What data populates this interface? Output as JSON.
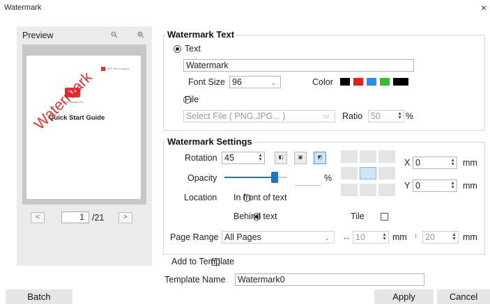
{
  "window": {
    "title": "Watermark",
    "close_glyph": "×"
  },
  "preview": {
    "label": "Preview",
    "zoom_out_icon": "zoom-out-icon",
    "zoom_in_icon": "zoom-in-icon",
    "document": {
      "logo_text": "PDF Technologies",
      "badge": "PDF",
      "badge_sub": "PDF Reader Pro",
      "title": "Quick Start Guide",
      "watermark": "Watermark"
    },
    "page_current": "1",
    "page_total": "/21",
    "prev_glyph": "<",
    "next_glyph": ">"
  },
  "watermark_text": {
    "title": "Watermark Text",
    "text_option": "Text",
    "text_value": "Watermark",
    "font_size_label": "Font Size",
    "font_size_value": "96",
    "color_label": "Color",
    "colors": [
      "#000000",
      "#ef1c1c",
      "#2f8af0",
      "#2fc12f",
      "#000000"
    ],
    "file_option": "File",
    "file_placeholder": "Select File ( PNG,JPG... )",
    "ratio_label": "Ratio",
    "ratio_value": "50",
    "ratio_unit": "%"
  },
  "watermark_settings": {
    "title": "Watermark Settings",
    "rotation_label": "Rotation",
    "rotation_value": "45",
    "opacity_label": "Opacity",
    "opacity_value": 0.8,
    "opacity_unit": "%",
    "location_label": "Location",
    "front_option": "In front of text",
    "behind_option": "Behind text",
    "tile_label": "Tile",
    "x_label": "X",
    "x_value": "0",
    "y_label": "Y",
    "y_value": "0",
    "unit_mm": "mm",
    "page_range_label": "Page Range",
    "page_range_value": "All Pages",
    "h_spacing_value": "10",
    "v_spacing_value": "20"
  },
  "template": {
    "add_label": "Add to Template",
    "name_label": "Template Name",
    "name_value": "Watermark0"
  },
  "buttons": {
    "batch": "Batch",
    "apply": "Apply",
    "cancel": "Cancel"
  }
}
